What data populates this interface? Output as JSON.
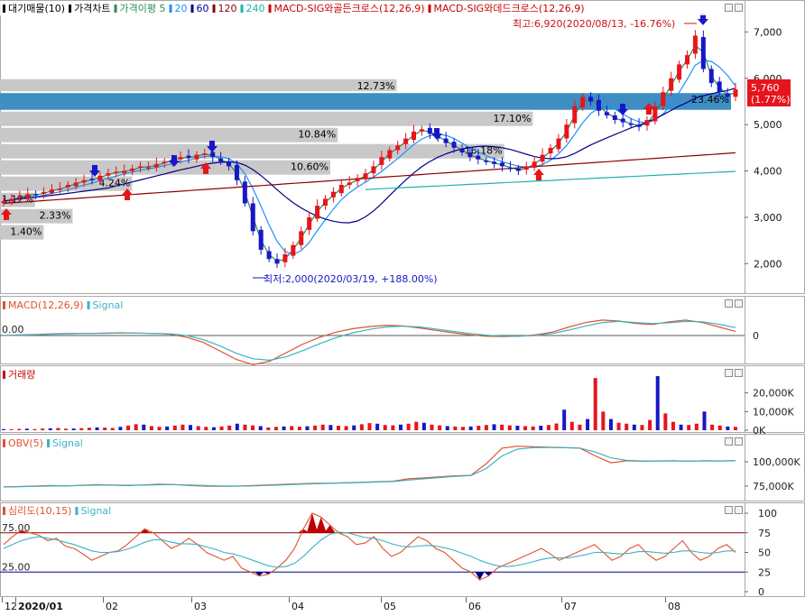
{
  "main_legend": [
    {
      "label": "대기매물(10)",
      "color": "#000000"
    },
    {
      "label": "가격차트",
      "color": "#000000"
    },
    {
      "label": "가격이평 5",
      "color": "#2e8b57"
    },
    {
      "label": "20",
      "color": "#1e90ff"
    },
    {
      "label": "60",
      "color": "#00008b"
    },
    {
      "label": "120",
      "color": "#8b0000"
    },
    {
      "label": "240",
      "color": "#20b2aa"
    },
    {
      "label": "MACD-SIG와골든크로스(12,26,9)",
      "color": "#cc0000"
    },
    {
      "label": "MACD-SIG와데드크로스(12,26,9)",
      "color": "#cc0000"
    }
  ],
  "annotations": {
    "high": "최고:6,920(2020/08/13, -16.76%)",
    "low": "최저:2,000(2020/03/19, +188.00%)"
  },
  "price_badge": {
    "value": "5,760",
    "change": "(1.77%)",
    "color": "#e8141b"
  },
  "volume_profile": {
    "color": "#c8c8c8",
    "highlight_color": "#3e8ec4",
    "bars": [
      {
        "label": "12.73%",
        "price_low": 5700,
        "price_high": 6000,
        "value": 12.73
      },
      {
        "label": "23.46%",
        "price_low": 5300,
        "price_high": 5700,
        "value": 23.46,
        "highlight": true
      },
      {
        "label": "17.10%",
        "price_low": 4950,
        "price_high": 5300,
        "value": 17.1
      },
      {
        "label": "10.84%",
        "price_low": 4600,
        "price_high": 4950,
        "value": 10.84
      },
      {
        "label": "16.18%",
        "price_low": 4250,
        "price_high": 4600,
        "value": 16.18
      },
      {
        "label": "10.60%",
        "price_low": 3900,
        "price_high": 4250,
        "value": 10.6
      },
      {
        "label": "4.24%",
        "price_low": 3550,
        "price_high": 3900,
        "value": 4.24
      },
      {
        "label": "1.12%",
        "price_low": 3200,
        "price_high": 3550,
        "value": 1.12
      },
      {
        "label": "2.33%",
        "price_low": 2850,
        "price_high": 3200,
        "value": 2.33
      },
      {
        "label": "1.40%",
        "price_low": 2500,
        "price_high": 2850,
        "value": 1.4
      }
    ]
  },
  "panels": {
    "macd": {
      "legend": [
        {
          "label": "MACD(12,26,9)",
          "color": "#e0522d"
        },
        {
          "label": "Signal",
          "color": "#3bb3c3"
        }
      ],
      "zero_label": "0.00",
      "ticks": [
        "0"
      ]
    },
    "volume": {
      "legend": [
        {
          "label": "거래량",
          "color": "#cc0000"
        }
      ],
      "ticks": [
        "20,000K",
        "10,000K",
        "0K"
      ]
    },
    "obv": {
      "legend": [
        {
          "label": "OBV(5)",
          "color": "#e0522d"
        },
        {
          "label": "Signal",
          "color": "#3bb3c3"
        }
      ],
      "ticks": [
        "100,000K",
        "75,000K"
      ]
    },
    "psy": {
      "legend": [
        {
          "label": "심리도(10,15)",
          "color": "#e0522d"
        },
        {
          "label": "Signal",
          "color": "#3bb3c3"
        }
      ],
      "level_labels": [
        "75.00",
        "25.00"
      ],
      "ticks": [
        "100",
        "75",
        "50",
        "25",
        "0"
      ]
    }
  },
  "x_axis": {
    "labels": [
      "12",
      "2020/01",
      "02",
      "03",
      "04",
      "05",
      "06",
      "07",
      "08"
    ]
  },
  "chart_data": [
    {
      "type": "candlestick",
      "title": "가격차트",
      "x": [
        "2019/12",
        "2020/01",
        "2020/02",
        "2020/03",
        "2020/04",
        "2020/05",
        "2020/06",
        "2020/07",
        "2020/08"
      ],
      "ylim": [
        1500,
        7300
      ],
      "yticks": [
        2000,
        3000,
        4000,
        5000,
        6000,
        7000
      ],
      "ytick_labels": [
        "2,000",
        "3,000",
        "4,000",
        "5,000",
        "6,000",
        "7,000"
      ],
      "close_series": [
        3350,
        3400,
        3450,
        3500,
        3480,
        3550,
        3600,
        3620,
        3700,
        3750,
        3800,
        3820,
        3900,
        3950,
        3980,
        4000,
        4050,
        4100,
        4080,
        4150,
        4200,
        4250,
        4300,
        4280,
        4350,
        4380,
        4300,
        4200,
        4100,
        3800,
        3300,
        2700,
        2300,
        2100,
        2000,
        2200,
        2400,
        2700,
        3000,
        3250,
        3400,
        3550,
        3700,
        3750,
        3850,
        3950,
        4100,
        4300,
        4450,
        4550,
        4700,
        4850,
        4900,
        4800,
        4700,
        4600,
        4500,
        4400,
        4300,
        4250,
        4200,
        4150,
        4100,
        4050,
        4000,
        4100,
        4200,
        4350,
        4500,
        4700,
        5000,
        5400,
        5600,
        5500,
        5300,
        5200,
        5100,
        5050,
        5000,
        4950,
        5100,
        5400,
        5700,
        6000,
        6300,
        6500,
        6920,
        6200,
        5900,
        5700,
        5600,
        5760
      ],
      "series": [
        {
          "name": "5",
          "color": "#2e8b57"
        },
        {
          "name": "20",
          "color": "#1e90ff"
        },
        {
          "name": "60",
          "color": "#00008b"
        },
        {
          "name": "120",
          "color": "#8b0000"
        },
        {
          "name": "240",
          "color": "#20b2aa"
        }
      ]
    },
    {
      "type": "line",
      "title": "MACD(12,26,9)",
      "zero_line": 0,
      "series": [
        {
          "name": "MACD(12,26,9)",
          "color": "#e0522d",
          "values": [
            0,
            0.02,
            0.03,
            0.05,
            0.06,
            0.06,
            0.07,
            0.08,
            0.07,
            0.06,
            0.04,
            -0.05,
            -0.2,
            -0.45,
            -0.7,
            -0.85,
            -0.75,
            -0.5,
            -0.25,
            -0.05,
            0.1,
            0.2,
            0.26,
            0.3,
            0.28,
            0.22,
            0.15,
            0.08,
            0.02,
            -0.02,
            -0.03,
            -0.02,
            0.02,
            0.1,
            0.25,
            0.38,
            0.45,
            0.42,
            0.35,
            0.32,
            0.4,
            0.45,
            0.38,
            0.25,
            0.12
          ]
        },
        {
          "name": "Signal",
          "color": "#3bb3c3",
          "values": [
            0,
            0.01,
            0.02,
            0.04,
            0.05,
            0.06,
            0.06,
            0.07,
            0.07,
            0.06,
            0.05,
            0.0,
            -0.12,
            -0.3,
            -0.52,
            -0.68,
            -0.72,
            -0.62,
            -0.44,
            -0.24,
            -0.06,
            0.08,
            0.18,
            0.25,
            0.27,
            0.25,
            0.19,
            0.12,
            0.06,
            0.01,
            -0.02,
            -0.02,
            0.0,
            0.06,
            0.16,
            0.28,
            0.38,
            0.41,
            0.38,
            0.35,
            0.37,
            0.41,
            0.4,
            0.33,
            0.23
          ]
        }
      ]
    },
    {
      "type": "bar",
      "title": "거래량",
      "ylim": [
        0,
        30000
      ],
      "unit": "K",
      "values": [
        600,
        500,
        700,
        800,
        600,
        900,
        1000,
        1200,
        800,
        900,
        1100,
        1300,
        1500,
        1400,
        1200,
        1800,
        2500,
        3200,
        3000,
        2200,
        1800,
        2000,
        2500,
        3000,
        2800,
        2200,
        1800,
        1600,
        2000,
        2500,
        3500,
        3000,
        2600,
        2200,
        1500,
        1800,
        2000,
        2200,
        1900,
        2100,
        2500,
        3000,
        2800,
        2400,
        2200,
        2600,
        3200,
        3800,
        3500,
        2800,
        2600,
        3000,
        3500,
        4500,
        4000,
        3000,
        2600,
        2200,
        2000,
        1800,
        2000,
        2400,
        2800,
        3200,
        3000,
        2600,
        2400,
        2200,
        2000,
        2400,
        2800,
        3600,
        11000,
        4500,
        3000,
        6000,
        28000,
        10000,
        6000,
        4000,
        3500,
        3000,
        2800,
        5500,
        29000,
        9000,
        4500,
        3000,
        2800,
        3500,
        10000,
        3000,
        2500,
        2000,
        1800
      ]
    },
    {
      "type": "line",
      "title": "OBV(5)",
      "ylim": [
        62000,
        125000
      ],
      "unit": "K",
      "series": [
        {
          "name": "OBV(5)",
          "color": "#e0522d",
          "values": [
            74000,
            74500,
            75000,
            75500,
            75200,
            75800,
            76500,
            76000,
            75500,
            76200,
            77000,
            76500,
            75500,
            75000,
            74800,
            75000,
            75500,
            76200,
            76800,
            77300,
            77800,
            78000,
            78500,
            79000,
            79500,
            80000,
            82500,
            83500,
            84500,
            85500,
            86000,
            98000,
            114000,
            116000,
            115500,
            115000,
            114500,
            114000,
            106000,
            99000,
            101000,
            100500,
            100800,
            101000,
            100500,
            101000,
            100800,
            101200
          ]
        },
        {
          "name": "Signal",
          "color": "#3bb3c3",
          "values": [
            74200,
            74400,
            74700,
            75100,
            75300,
            75600,
            76000,
            76100,
            75900,
            76000,
            76400,
            76500,
            76000,
            75500,
            75200,
            75000,
            75200,
            75700,
            76300,
            76900,
            77400,
            77800,
            78200,
            78700,
            79200,
            79700,
            81200,
            82500,
            83800,
            85000,
            85800,
            93000,
            106000,
            113000,
            114500,
            114600,
            114400,
            114100,
            110000,
            104000,
            101500,
            100800,
            100800,
            100900,
            100700,
            100900,
            100800,
            101000
          ]
        }
      ]
    },
    {
      "type": "line",
      "title": "심리도(10,15)",
      "ylim": [
        0,
        105
      ],
      "levels": [
        75,
        25
      ],
      "series": [
        {
          "name": "심리도(10,15)",
          "color": "#e0522d",
          "values": [
            60,
            70,
            78,
            75,
            72,
            65,
            68,
            58,
            55,
            48,
            40,
            45,
            50,
            52,
            60,
            70,
            80,
            75,
            65,
            55,
            60,
            68,
            60,
            50,
            45,
            40,
            45,
            30,
            25,
            20,
            22,
            30,
            40,
            55,
            80,
            100,
            95,
            85,
            75,
            70,
            60,
            62,
            70,
            55,
            45,
            50,
            60,
            70,
            65,
            55,
            50,
            40,
            30,
            25,
            15,
            20,
            30,
            35,
            40,
            45,
            50,
            55,
            48,
            40,
            45,
            50,
            55,
            60,
            50,
            40,
            45,
            55,
            60,
            48,
            40,
            45,
            55,
            65,
            50,
            40,
            45,
            55,
            60,
            50
          ]
        },
        {
          "name": "Signal",
          "color": "#3bb3c3",
          "values": [
            55,
            60,
            65,
            68,
            70,
            68,
            66,
            63,
            60,
            56,
            52,
            50,
            50,
            51,
            54,
            58,
            63,
            66,
            66,
            63,
            61,
            61,
            60,
            57,
            54,
            50,
            48,
            45,
            41,
            37,
            33,
            31,
            32,
            36,
            45,
            56,
            66,
            73,
            76,
            75,
            72,
            69,
            68,
            65,
            61,
            58,
            57,
            58,
            59,
            58,
            56,
            53,
            49,
            45,
            40,
            36,
            33,
            32,
            33,
            35,
            38,
            41,
            43,
            43,
            43,
            45,
            47,
            50,
            50,
            49,
            48,
            49,
            51,
            51,
            50,
            49,
            50,
            52,
            52,
            50,
            49,
            50,
            52,
            52
          ]
        }
      ]
    }
  ]
}
